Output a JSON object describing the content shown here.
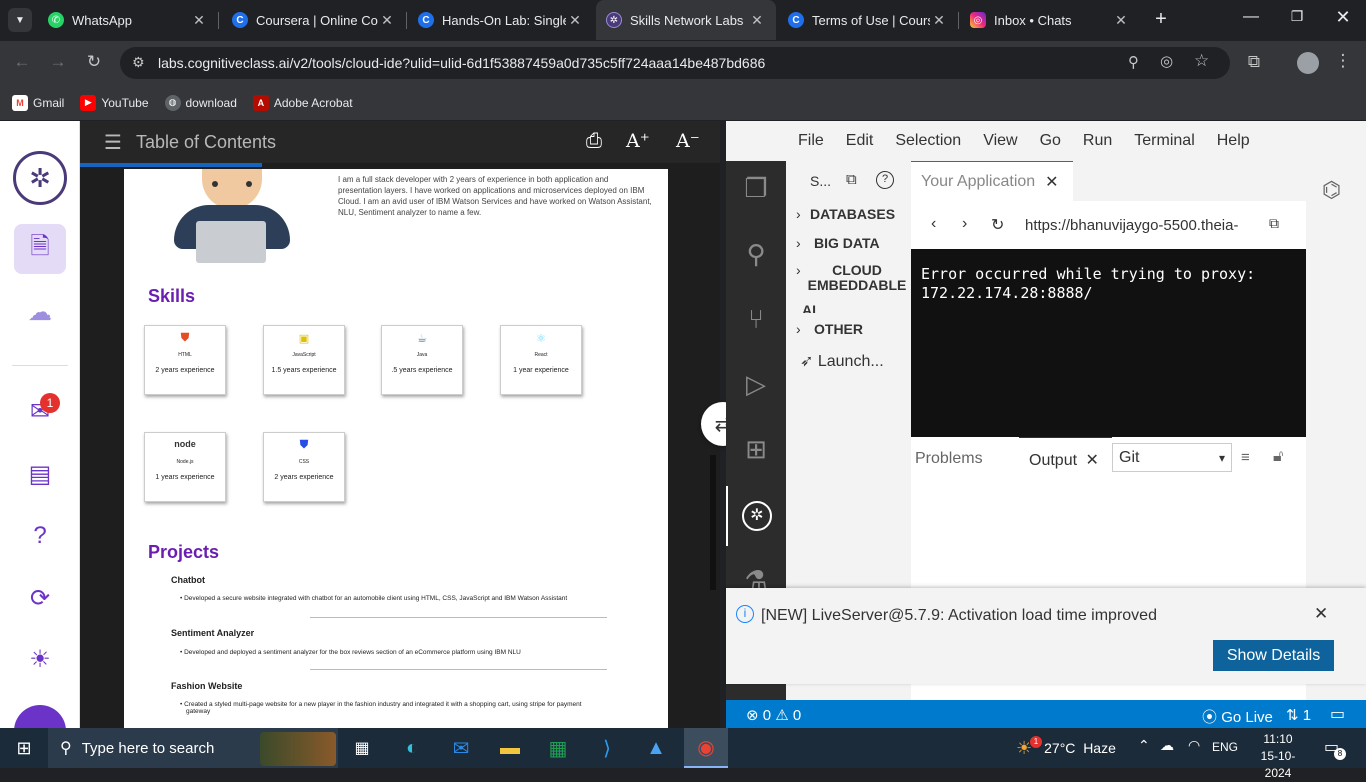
{
  "browser": {
    "tabs": [
      {
        "title": "WhatsApp",
        "icon": "whatsapp-icon"
      },
      {
        "title": "Coursera | Online Cou",
        "icon": "coursera-icon"
      },
      {
        "title": "Hands-On Lab: Single",
        "icon": "coursera-icon"
      },
      {
        "title": "Skills Network Labs",
        "icon": "skills-network-icon"
      },
      {
        "title": "Terms of Use | Course",
        "icon": "coursera-icon"
      },
      {
        "title": "Inbox • Chats",
        "icon": "instagram-icon"
      }
    ],
    "url": "labs.cognitiveclass.ai/v2/tools/cloud-ide?ulid=ulid-6d1f53887459a0d735c5ff724aaa14be487bd686",
    "bookmarks": [
      "Gmail",
      "YouTube",
      "download",
      "Adobe Acrobat"
    ]
  },
  "lab": {
    "toc_label": "Table of Contents",
    "sidebar_badge": "1",
    "resume": {
      "about": "I am a full stack developer with 2 years of experience in both application and presentation layers. I have worked on applications and microservices deployed on IBM Cloud. I am an avid user of IBM Watson Services and have worked on Watson Assistant, NLU, Sentiment analyzer to name a few.",
      "skills_heading": "Skills",
      "skills": [
        {
          "name": "HTML",
          "exp": "2 years experience"
        },
        {
          "name": "JavaScript",
          "exp": "1.5 years experience"
        },
        {
          "name": "Java",
          "exp": ".5 years experience"
        },
        {
          "name": "React",
          "exp": "1 year experience"
        },
        {
          "name": "Node.js",
          "exp": "1 years experience"
        },
        {
          "name": "CSS",
          "exp": "2 years experience"
        }
      ],
      "projects_heading": "Projects",
      "projects": [
        {
          "title": "Chatbot",
          "desc": "Developed a secure website integrated with chatbot for an automobile client using HTML, CSS, JavaScript and IBM Watson Assistant"
        },
        {
          "title": "Sentiment Analyzer",
          "desc": "Developed and deployed a sentiment analyzer for the box reviews section of an eCommerce platform using IBM NLU"
        },
        {
          "title": "Fashion Website",
          "desc": "Created a styled multi-page website for a new player in the fashion industry and integrated it with a shopping cart, using stripe for payment gateway"
        }
      ]
    }
  },
  "ide": {
    "menu": [
      "File",
      "Edit",
      "Selection",
      "View",
      "Go",
      "Run",
      "Terminal",
      "Help"
    ],
    "explorer_title": "S...",
    "explorer_sections": [
      "DATABASES",
      "BIG DATA",
      "CLOUD EMBEDDABLE",
      "AI",
      "OTHER"
    ],
    "launch_label": "Launch...",
    "app_tab": "Your Application",
    "app_url": "https://bhanuvijaygo-5500.theia-",
    "app_error": "Error occurred while trying to proxy: 172.22.174.28:8888/",
    "panel_tabs": {
      "problems": "Problems",
      "output": "Output"
    },
    "output_channel": "Git",
    "notification": "[NEW] LiveServer@5.7.9: Activation load time improved",
    "show_details": "Show Details",
    "status": {
      "errors": "0",
      "warnings": "0",
      "go_live": "Go Live",
      "ports": "1"
    }
  },
  "taskbar": {
    "search_placeholder": "Type here to search",
    "weather": "27°C  Haze",
    "weather_badge": "1",
    "lang": "ENG",
    "time": "11:10",
    "date": "15-10-2024",
    "notif_count": "8"
  },
  "colors": {
    "accent": "#6b33c7",
    "vscode_blue": "#007acc",
    "chrome_dark": "#202124"
  }
}
